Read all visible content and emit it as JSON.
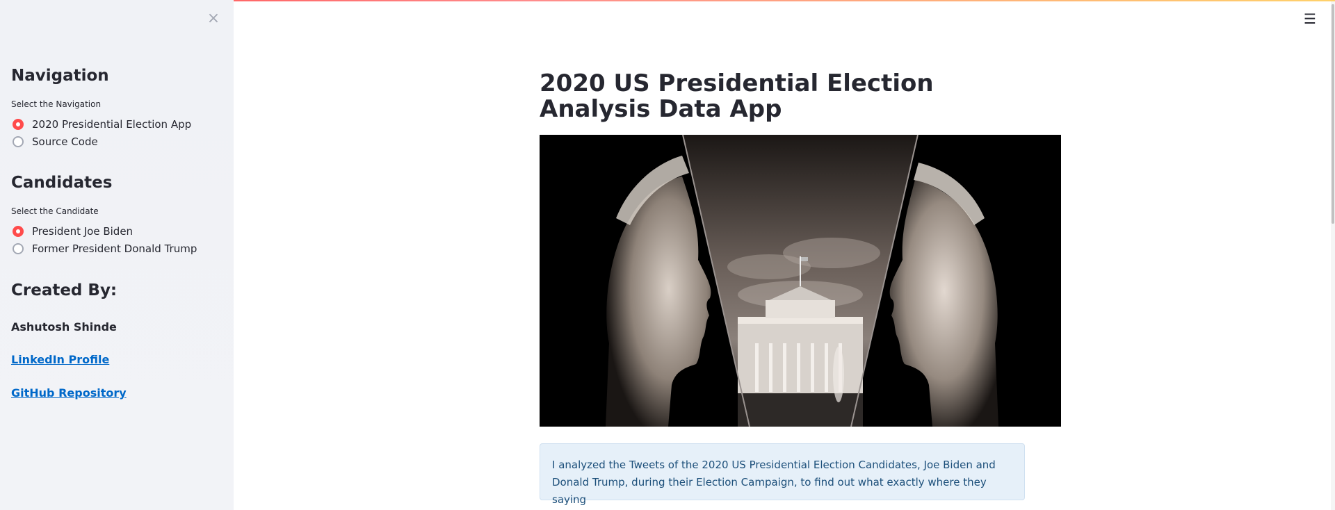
{
  "sidebar": {
    "close_icon": "close-icon",
    "navigation": {
      "title": "Navigation",
      "label": "Select the Navigation",
      "options": [
        {
          "label": "2020 Presidential Election App",
          "selected": true
        },
        {
          "label": "Source Code",
          "selected": false
        }
      ]
    },
    "candidates": {
      "title": "Candidates",
      "label": "Select the Candidate",
      "options": [
        {
          "label": "President Joe Biden",
          "selected": true
        },
        {
          "label": "Former President Donald Trump",
          "selected": false
        }
      ]
    },
    "created_by": {
      "title": "Created By:",
      "author": "Ashutosh Shinde",
      "links": [
        {
          "label": "LinkedIn Profile"
        },
        {
          "label": "GitHub Repository"
        }
      ]
    }
  },
  "main": {
    "menu_icon": "hamburger-menu-icon",
    "title": "2020 US Presidential Election Analysis Data App",
    "info_text": "I analyzed the Tweets of the 2020 US Presidential Election Candidates, Joe Biden and Donald Trump, during their Election Campaign, to find out what exactly where they saying"
  },
  "colors": {
    "accent": "#ff4b4b",
    "link": "#0068c9",
    "sidebar_bg": "#f0f2f6",
    "info_bg": "#e6f0f9",
    "info_text": "#1c4f7a"
  }
}
